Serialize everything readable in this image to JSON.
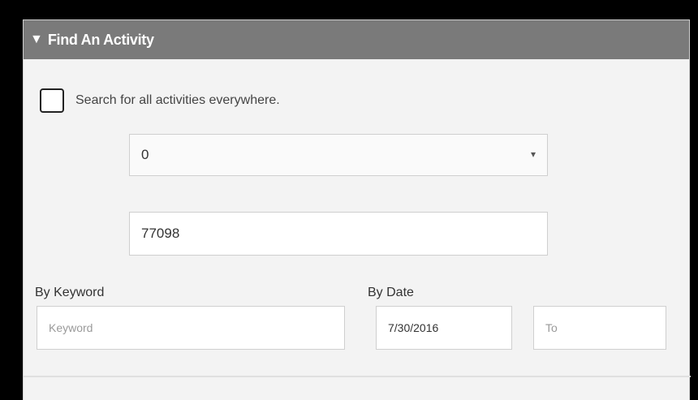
{
  "panel": {
    "caret_icon": "▼",
    "title": "Find An Activity"
  },
  "search_all": {
    "label": "Search for all activities everywhere.",
    "checked": false
  },
  "distance_select": {
    "value": "0",
    "chevron_icon": "chevron-down-icon"
  },
  "zip_input": {
    "value": "77098"
  },
  "keyword": {
    "label": "By Keyword",
    "placeholder": "Keyword",
    "value": ""
  },
  "date": {
    "label": "By Date",
    "from_value": "7/30/2016",
    "to_placeholder": "To"
  },
  "colors": {
    "header_bg": "#7a7a7a",
    "panel_bg": "#f3f3f3",
    "frame": "#000000"
  }
}
